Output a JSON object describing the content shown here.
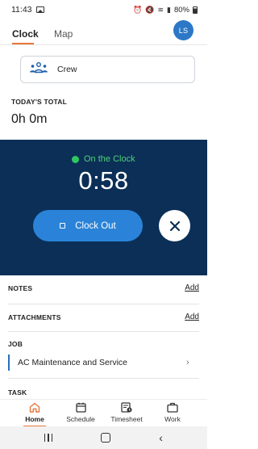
{
  "status_bar": {
    "time": "11:43",
    "battery": "80%",
    "icons": [
      "image-icon",
      "alarm-icon",
      "mute-icon",
      "wifi-icon",
      "signal-icon",
      "battery-icon"
    ]
  },
  "tabs": [
    {
      "label": "Clock",
      "active": true
    },
    {
      "label": "Map",
      "active": false
    }
  ],
  "avatar": {
    "initials": "LS",
    "color": "#2d78c6"
  },
  "crew": {
    "label": "Crew",
    "icon": "crew-icon"
  },
  "today": {
    "label": "TODAY'S TOTAL",
    "value": "0h 0m"
  },
  "clock_panel": {
    "status": "On the Clock",
    "timer": "0:58",
    "clock_out_label": "Clock Out",
    "background": "#0b2f57",
    "accent": "#2a83d8",
    "status_color": "#2fc760"
  },
  "notes": {
    "label": "NOTES",
    "action": "Add"
  },
  "attachments": {
    "label": "ATTACHMENTS",
    "action": "Add"
  },
  "job": {
    "label": "JOB",
    "value": "AC Maintenance and Service"
  },
  "task": {
    "label": "TASK"
  },
  "bottom_nav": [
    {
      "label": "Home",
      "icon": "home-icon",
      "active": true
    },
    {
      "label": "Schedule",
      "icon": "calendar-icon",
      "active": false
    },
    {
      "label": "Timesheet",
      "icon": "timesheet-icon",
      "active": false
    },
    {
      "label": "Work",
      "icon": "briefcase-icon",
      "active": false
    }
  ],
  "brand_accent": "#e8763a"
}
